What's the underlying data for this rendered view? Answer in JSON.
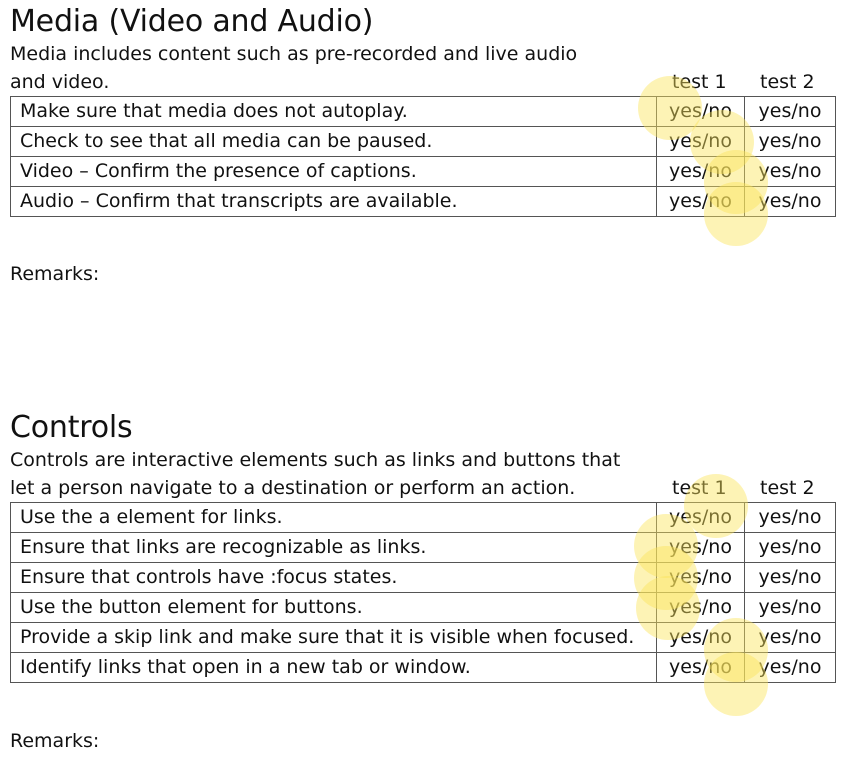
{
  "media": {
    "title": "Media (Video and Audio)",
    "desc_line1": "Media includes content such as pre-recorded and live audio",
    "desc_line2": "and video.",
    "test1_label": "test 1",
    "test2_label": "test 2",
    "rows": [
      {
        "item": "Make sure that media does not autoplay.",
        "t1": "yes/no",
        "t2": "yes/no"
      },
      {
        "item": "Check to see that all media can be paused.",
        "t1": "yes/no",
        "t2": "yes/no"
      },
      {
        "item": "Video – Confirm the presence of captions.",
        "t1": "yes/no",
        "t2": "yes/no"
      },
      {
        "item": "Audio – Confirm that transcripts are available.",
        "t1": "yes/no",
        "t2": "yes/no"
      }
    ],
    "remarks_label": "Remarks:"
  },
  "controls": {
    "title": "Controls",
    "desc_line1": "Controls are interactive elements such as links and buttons that",
    "desc_line2": "let a person navigate to a destination or perform an action.",
    "test1_label": "test 1",
    "test2_label": "test 2",
    "rows": [
      {
        "item": "Use the a element for links.",
        "t1": "yes/no",
        "t2": "yes/no"
      },
      {
        "item": "Ensure that links are recognizable as links.",
        "t1": "yes/no",
        "t2": "yes/no"
      },
      {
        "item": "Ensure that controls have :focus states.",
        "t1": "yes/no",
        "t2": "yes/no"
      },
      {
        "item": "Use the button element for buttons.",
        "t1": "yes/no",
        "t2": "yes/no"
      },
      {
        "item": "Provide a skip link and make sure that it is visible when focused.",
        "t1": "yes/no",
        "t2": "yes/no"
      },
      {
        "item": "Identify links that open in a new tab or window.",
        "t1": "yes/no",
        "t2": "yes/no"
      }
    ],
    "remarks_label": "Remarks:"
  },
  "highlight_color": "#fae45a"
}
